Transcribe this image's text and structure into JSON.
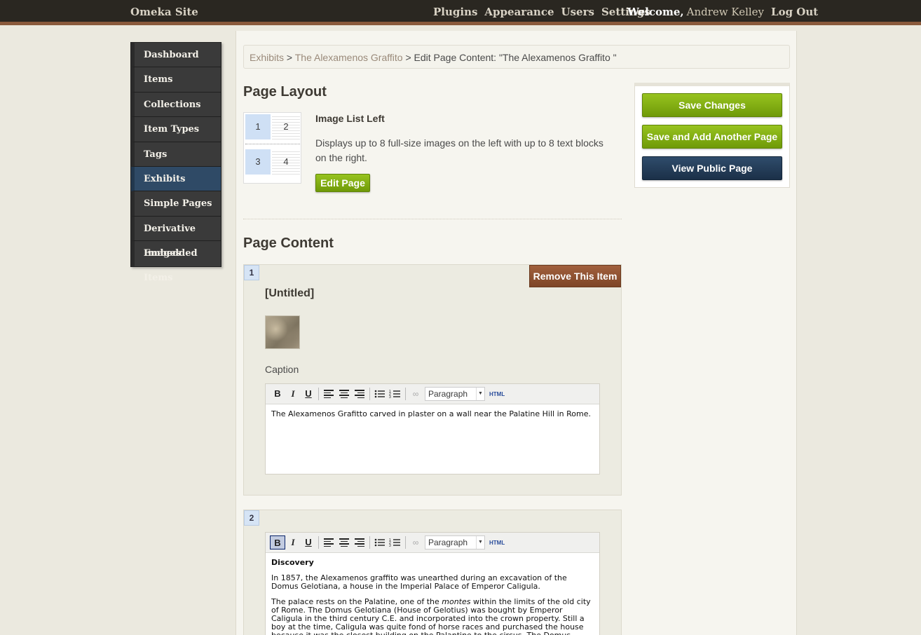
{
  "topbar": {
    "site_title": "Omeka Site",
    "nav": [
      "Plugins",
      "Appearance",
      "Users",
      "Settings"
    ],
    "welcome": "Welcome,",
    "user_name": "Andrew Kelley",
    "logout": "Log Out"
  },
  "sidebar": {
    "items": [
      {
        "label": "Dashboard"
      },
      {
        "label": "Items"
      },
      {
        "label": "Collections"
      },
      {
        "label": "Item Types"
      },
      {
        "label": "Tags"
      },
      {
        "label": "Exhibits",
        "active": true
      },
      {
        "label": "Simple Pages"
      },
      {
        "label": "Derivative Images"
      },
      {
        "label": "Embedded Items"
      }
    ]
  },
  "breadcrumb": {
    "exhibits": "Exhibits",
    "sep1": " > ",
    "exhibit": "The Alexamenos Graffito",
    "sep2": " > ",
    "current": "Edit Page Content: \"The Alexamenos Graffito \""
  },
  "layout": {
    "heading": "Page Layout",
    "name": "Image List Left",
    "description": "Displays up to 8 full-size images on the left with up to 8 text blocks on the right.",
    "edit_button": "Edit Page",
    "thumb_cells": [
      "1",
      "2",
      "3",
      "4"
    ]
  },
  "actions": {
    "save": "Save Changes",
    "save_add": "Save and Add Another Page",
    "view_public": "View Public Page"
  },
  "content": {
    "heading": "Page Content",
    "blocks": [
      {
        "number": "1",
        "remove_label": "Remove This Item",
        "item_title": "[Untitled]",
        "caption_label": "Caption",
        "editor": {
          "format": "Paragraph",
          "html_label": "HTML",
          "text": "The Alexamenos Grafitto carved in plaster on a wall near the Palatine Hill in Rome."
        }
      },
      {
        "number": "2",
        "editor": {
          "format": "Paragraph",
          "html_label": "HTML",
          "heading": "Discovery",
          "p1": "In 1857, the Alexamenos graffito was unearthed during an excavation of the Domus Gelotiana, a house in the Imperial Palace of Emperor Caligula.",
          "p2_before": "The palace rests on the Palatine, one of the ",
          "p2_em": "montes",
          "p2_after": " within the limits of the old city of Rome. The Domus Gelotiana (House of Gelotius) was bought by Emperor Caligula in the third century C.E. and incorporated into the crown property. Still a boy at the time, Caligula was quite fond of horse races and purchased the house because it was the closest building on the Palantine to the circus. The Domus consists of an outer part that remains"
        }
      }
    ]
  },
  "toolbar_buttons": {
    "bold": "B",
    "italic": "I",
    "underline": "U"
  }
}
